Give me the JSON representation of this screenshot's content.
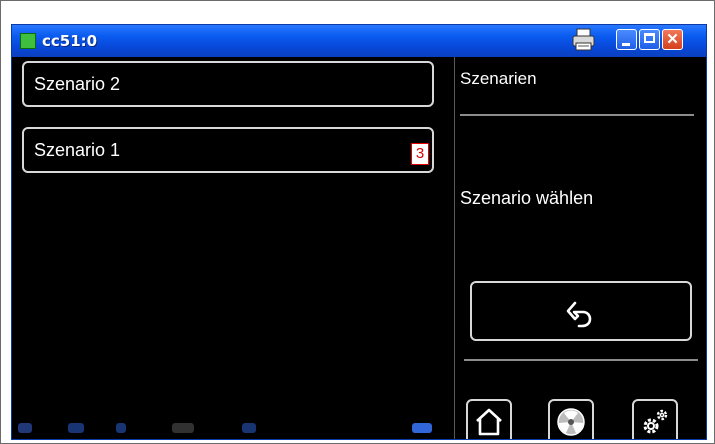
{
  "window": {
    "title": "cc51:0",
    "buttons": [
      "print",
      "minimize",
      "maximize",
      "close"
    ],
    "close_glyph": "✕"
  },
  "scenarios": {
    "items": [
      {
        "label": "Szenario 2"
      },
      {
        "label": "Szenario 1"
      }
    ],
    "badge": "3"
  },
  "panel": {
    "title": "Szenarien",
    "subtitle": "Szenario wählen"
  },
  "icons": {
    "back": "undo-arrow-icon",
    "home": "home-icon",
    "fan": "fan-icon",
    "settings": "gears-icon"
  },
  "colors": {
    "titlebar": "#0a5bf0",
    "background": "#000000",
    "button_border": "#d8d8d8",
    "badge": "#e00000"
  }
}
